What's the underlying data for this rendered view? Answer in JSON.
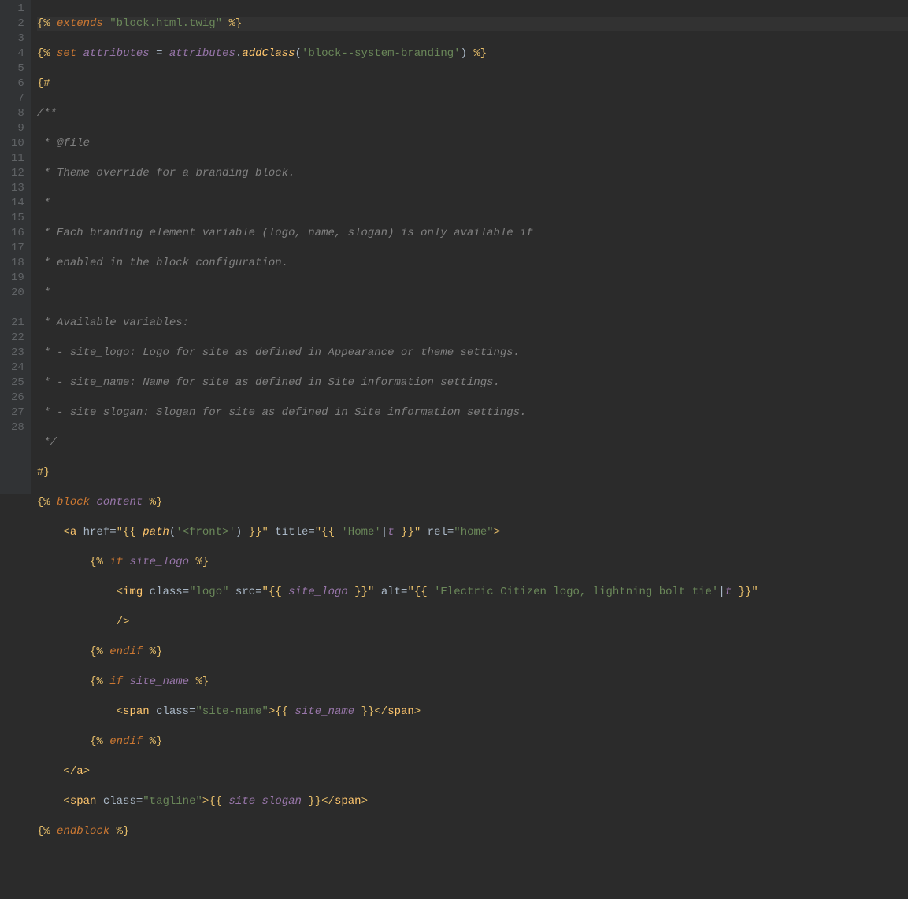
{
  "gutter": {
    "start": 1,
    "end": 28
  },
  "code": {
    "l1": {
      "d1": "{%",
      "kw": "extends",
      "str": "\"block.html.twig\"",
      "d2": "%}"
    },
    "l2": {
      "d1": "{%",
      "kw": "set",
      "v1": "attributes",
      "eq": "=",
      "v2": "attributes",
      "dot": ".",
      "fn": "addClass",
      "p1": "(",
      "str": "'block--system-branding'",
      "p2": ")",
      "d2": "%}"
    },
    "l3": {
      "d1": "{#"
    },
    "l4": {
      "c": "/**"
    },
    "l5": {
      "c": " * @file"
    },
    "l6": {
      "c": " * Theme override for a branding block."
    },
    "l7": {
      "c": " *"
    },
    "l8": {
      "c": " * Each branding element variable (logo, name, slogan) is only available if"
    },
    "l9": {
      "c": " * enabled in the block configuration."
    },
    "l10": {
      "c": " *"
    },
    "l11": {
      "c": " * Available variables:"
    },
    "l12": {
      "c": " * - site_logo: Logo for site as defined in Appearance or theme settings."
    },
    "l13": {
      "c": " * - site_name: Name for site as defined in Site information settings."
    },
    "l14": {
      "c": " * - site_slogan: Slogan for site as defined in Site information settings."
    },
    "l15": {
      "c": " */"
    },
    "l16": {
      "d1": "#}"
    },
    "l17": {
      "d1": "{%",
      "kw": "block",
      "id": "content",
      "d2": "%}"
    },
    "l18": {
      "t1": "<",
      "tn": "a",
      "a1": "href",
      "d1": "\"{{",
      "fn": "path",
      "p1": "(",
      "str1": "'<front>'",
      "p2": ")",
      "d2": "}}\"",
      "a2": "title",
      "d3": "\"{{",
      "str2": "'Home'",
      "pipe": "|",
      "flt": "t",
      "d4": "}}\"",
      "a3": "rel",
      "str3": "\"home\"",
      "t2": ">"
    },
    "l19": {
      "d1": "{%",
      "kw": "if",
      "id": "site_logo",
      "d2": "%}"
    },
    "l20": {
      "t1": "<",
      "tn": "img",
      "a1": "class",
      "str1": "\"logo\"",
      "a2": "src",
      "d1": "\"{{",
      "id": "site_logo",
      "d2": "}}\"",
      "a3": "alt",
      "d3": "\"{{",
      "str2": "'Electric Citizen logo, lightning bolt tie'",
      "pipe": "|",
      "flt": "t",
      "d4": "}}\""
    },
    "l20b": {
      "t": "/>"
    },
    "l21": {
      "d1": "{%",
      "kw": "endif",
      "d2": "%}"
    },
    "l22": {
      "d1": "{%",
      "kw": "if",
      "id": "site_name",
      "d2": "%}"
    },
    "l23": {
      "t1": "<",
      "tn": "span",
      "a1": "class",
      "str1": "\"site-name\"",
      "t2": ">",
      "d1": "{{",
      "id": "site_name",
      "d2": "}}",
      "t3": "</",
      "tn2": "span",
      "t4": ">"
    },
    "l24": {
      "d1": "{%",
      "kw": "endif",
      "d2": "%}"
    },
    "l25": {
      "t1": "</",
      "tn": "a",
      "t2": ">"
    },
    "l26": {
      "t1": "<",
      "tn": "span",
      "a1": "class",
      "str1": "\"tagline\"",
      "t2": ">",
      "d1": "{{",
      "id": "site_slogan",
      "d2": "}}",
      "t3": "</",
      "tn2": "span",
      "t4": ">"
    },
    "l27": {
      "d1": "{%",
      "kw": "endblock",
      "d2": "%}"
    }
  }
}
